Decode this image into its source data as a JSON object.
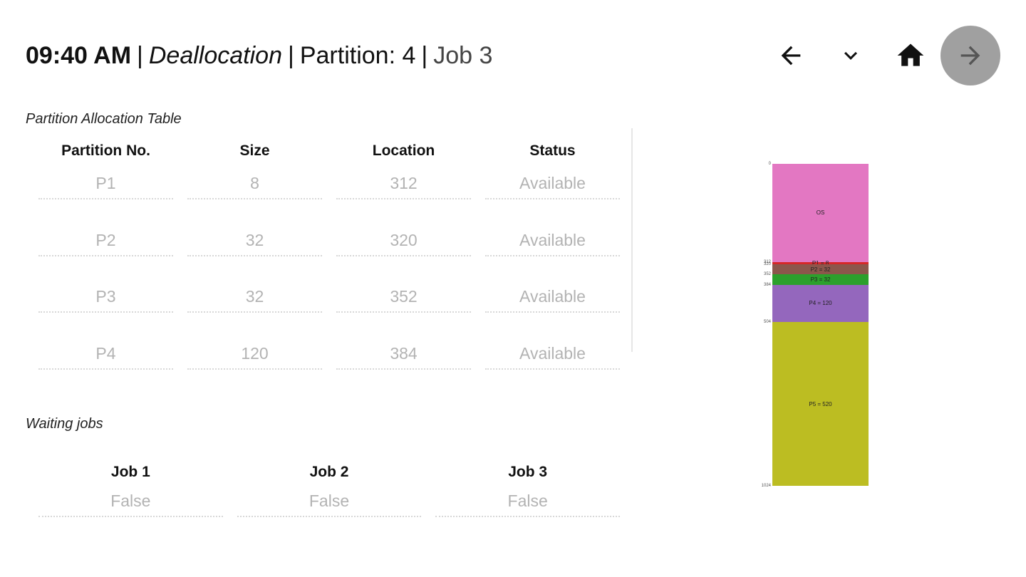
{
  "header": {
    "time": "09:40 AM",
    "mode": "Deallocation",
    "partition": "Partition: 4",
    "job": "Job 3",
    "separator": "|"
  },
  "nav": {
    "icons": [
      "arrow-left-icon",
      "chevron-down-icon",
      "home-icon",
      "arrow-right-icon"
    ],
    "next_bg": "#a0a0a0"
  },
  "partition_table": {
    "title": "Partition Allocation Table",
    "columns": [
      "Partition No.",
      "Size",
      "Location",
      "Status"
    ],
    "rows": [
      [
        "P1",
        "8",
        "312",
        "Available"
      ],
      [
        "P2",
        "32",
        "320",
        "Available"
      ],
      [
        "P3",
        "32",
        "352",
        "Available"
      ],
      [
        "P4",
        "120",
        "384",
        "Available"
      ]
    ]
  },
  "waiting_jobs": {
    "title": "Waiting jobs",
    "columns": [
      "Job 1",
      "Job 2",
      "Job 3"
    ],
    "values": [
      "False",
      "False",
      "False"
    ]
  },
  "memory_map": {
    "total": 1024,
    "blocks": [
      {
        "label": "OS",
        "start": 0,
        "size": 312,
        "color": "#e377c2"
      },
      {
        "label": "P1 = 8",
        "start": 312,
        "size": 8,
        "color": "#d62728"
      },
      {
        "label": "P2 = 32",
        "start": 320,
        "size": 32,
        "color": "#8c564b"
      },
      {
        "label": "P3 = 32",
        "start": 352,
        "size": 32,
        "color": "#2ca02c"
      },
      {
        "label": "P4 = 120",
        "start": 384,
        "size": 120,
        "color": "#9467bd"
      },
      {
        "label": "P5 = 520",
        "start": 504,
        "size": 520,
        "color": "#bcbd22"
      }
    ],
    "ticks": [
      "0",
      "312",
      "320",
      "352",
      "384",
      "504",
      "1024"
    ]
  }
}
